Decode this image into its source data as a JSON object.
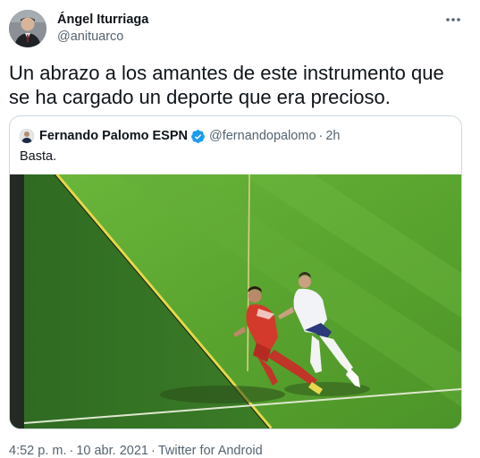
{
  "tweet": {
    "author_name": "Ángel Iturriaga",
    "author_handle": "@anituarco",
    "text": "Un abrazo a los amantes de este instrumento que se ha cargado un deporte que era precioso."
  },
  "quoted": {
    "author_name": "Fernando Palomo ESPN",
    "verified": true,
    "author_handle": "@fernandopalomo",
    "separator": "·",
    "time": "2h",
    "text": "Basta."
  },
  "footer": {
    "time": "4:52 p. m.",
    "separator": "·",
    "date": "10 abr. 2021",
    "separator2": "·",
    "source": "Twitter for Android"
  },
  "icons": {
    "more": "more-horizontal-icon",
    "verified": "verified-badge-icon"
  },
  "colors": {
    "verified_blue": "#1d9bf0",
    "secondary_text": "#536471",
    "border": "#cfd9de"
  }
}
